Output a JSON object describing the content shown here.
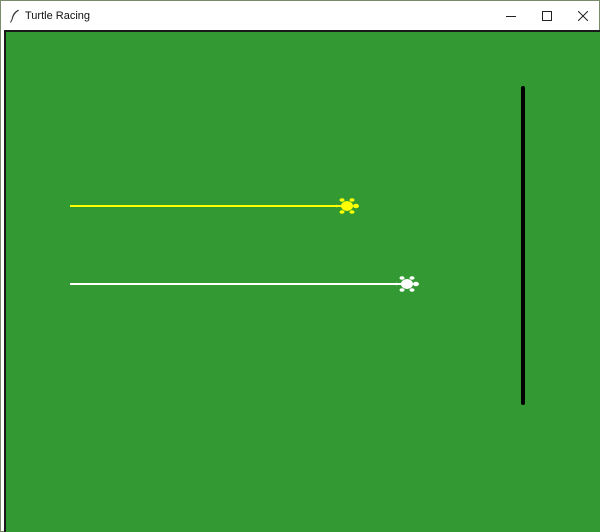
{
  "window": {
    "title": "Turtle Racing",
    "controls": {
      "minimize_icon": "minimize-icon",
      "maximize_icon": "maximize-icon",
      "close_icon": "close-icon"
    },
    "app_icon": "feather-icon"
  },
  "canvas": {
    "background_color": "#339933",
    "finish_line_color": "#000000",
    "turtles": [
      {
        "color": "#ffff00"
      },
      {
        "color": "#ffffff"
      }
    ]
  }
}
